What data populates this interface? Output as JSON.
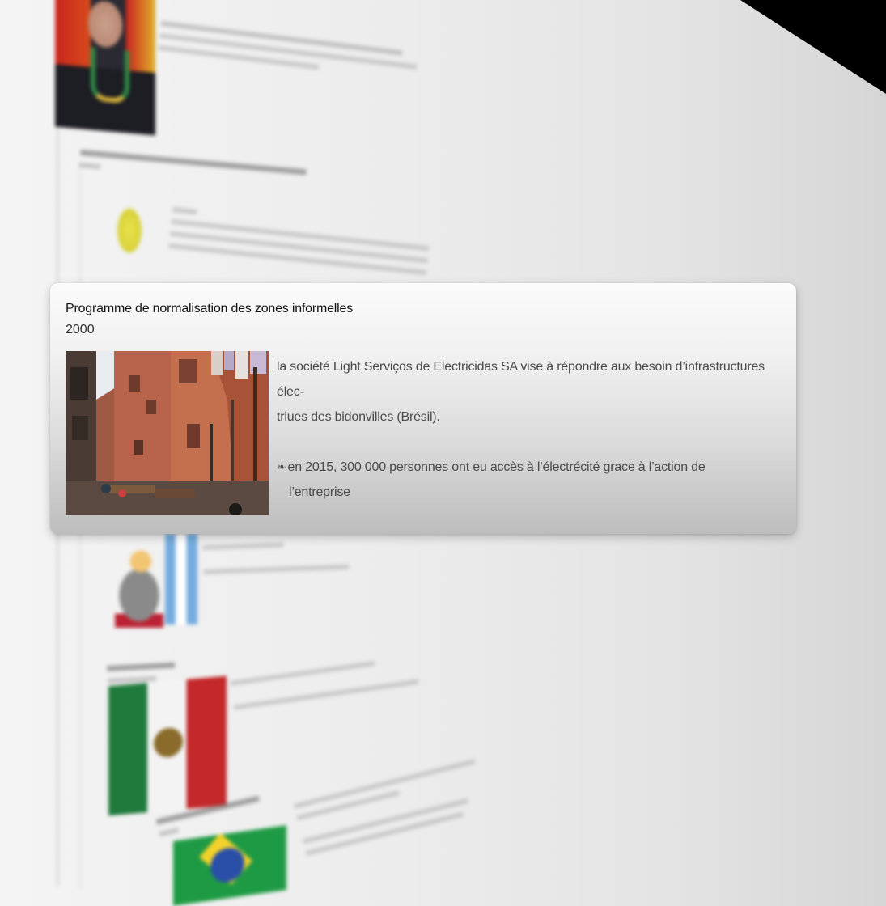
{
  "card": {
    "title": "Programme de normalisation des zones informelles",
    "year": "2000",
    "description_line1": "la société Light Serviços de Electricidas SA vise à répondre aux besoin d’infrastructures élec-",
    "description_line2": "triues des bidonvilles (Brésil).",
    "bullet_symbol": "❧",
    "bullet_line1": "en 2015, 300 000 personnes ont eu accès à l’électrécité grace à l’action de",
    "bullet_line2": "l’entreprise"
  },
  "background": {
    "corner_color": "#000000",
    "card_gradient_top": "#fbfbfb",
    "card_gradient_bottom": "#bdbdbd"
  }
}
